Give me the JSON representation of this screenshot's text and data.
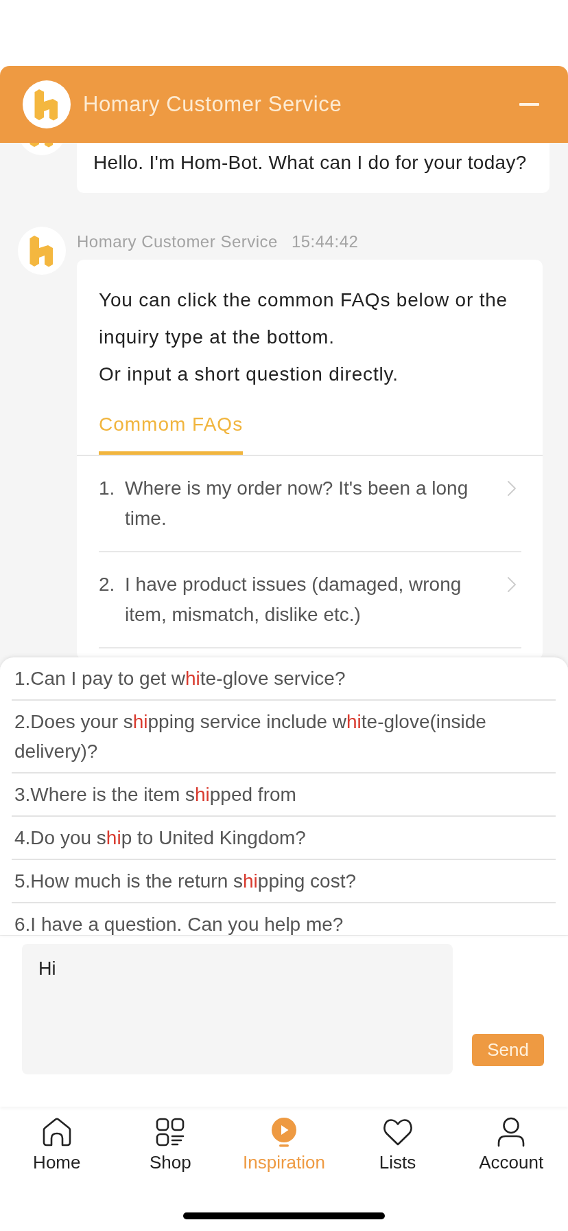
{
  "header": {
    "title": "Homary Customer Service"
  },
  "messages": [
    {
      "kind": "text",
      "text": "Hello. I'm Hom-Bot. What can I do for your today?"
    },
    {
      "kind": "faq_card",
      "sender": "Homary Customer Service",
      "time": "15:44:42",
      "paragraphs": [
        "You can click the common FAQs below or the inquiry type at the bottom.",
        "Or input a short question directly."
      ],
      "tabs": [
        {
          "label": "Commom FAQs",
          "selected": true
        }
      ],
      "faqs": [
        {
          "number": "1.",
          "text": "Where is my order now? It's been a long time."
        },
        {
          "number": "2.",
          "text": "I have product issues (damaged, wrong item, mismatch, dislike etc.)"
        }
      ]
    }
  ],
  "suggestions": [
    {
      "parts": [
        {
          "text": "1.Can I pay to get w",
          "match": false
        },
        {
          "text": "hi",
          "match": true
        },
        {
          "text": "te-glove service?",
          "match": false
        }
      ]
    },
    {
      "parts": [
        {
          "text": "2.Does your s",
          "match": false
        },
        {
          "text": "hi",
          "match": true
        },
        {
          "text": "pping service include w",
          "match": false
        },
        {
          "text": "hi",
          "match": true
        },
        {
          "text": "te-glove(inside delivery)?",
          "match": false
        }
      ]
    },
    {
      "parts": [
        {
          "text": "3.Where is the item s",
          "match": false
        },
        {
          "text": "hi",
          "match": true
        },
        {
          "text": "pped from",
          "match": false
        }
      ]
    },
    {
      "parts": [
        {
          "text": "4.Do you s",
          "match": false
        },
        {
          "text": "hi",
          "match": true
        },
        {
          "text": "p to United Kingdom?",
          "match": false
        }
      ]
    },
    {
      "parts": [
        {
          "text": "5.How much is the return s",
          "match": false
        },
        {
          "text": "hi",
          "match": true
        },
        {
          "text": "pping cost?",
          "match": false
        }
      ]
    },
    {
      "parts": [
        {
          "text": "6.I have a question. Can you help me?",
          "match": false
        }
      ]
    }
  ],
  "composer": {
    "value": "Hi",
    "send_label": "Send"
  },
  "nav": [
    {
      "label": "Home",
      "selected": false
    },
    {
      "label": "Shop",
      "selected": false
    },
    {
      "label": "Inspiration",
      "selected": true
    },
    {
      "label": "Lists",
      "selected": false
    },
    {
      "label": "Account",
      "selected": false
    }
  ]
}
